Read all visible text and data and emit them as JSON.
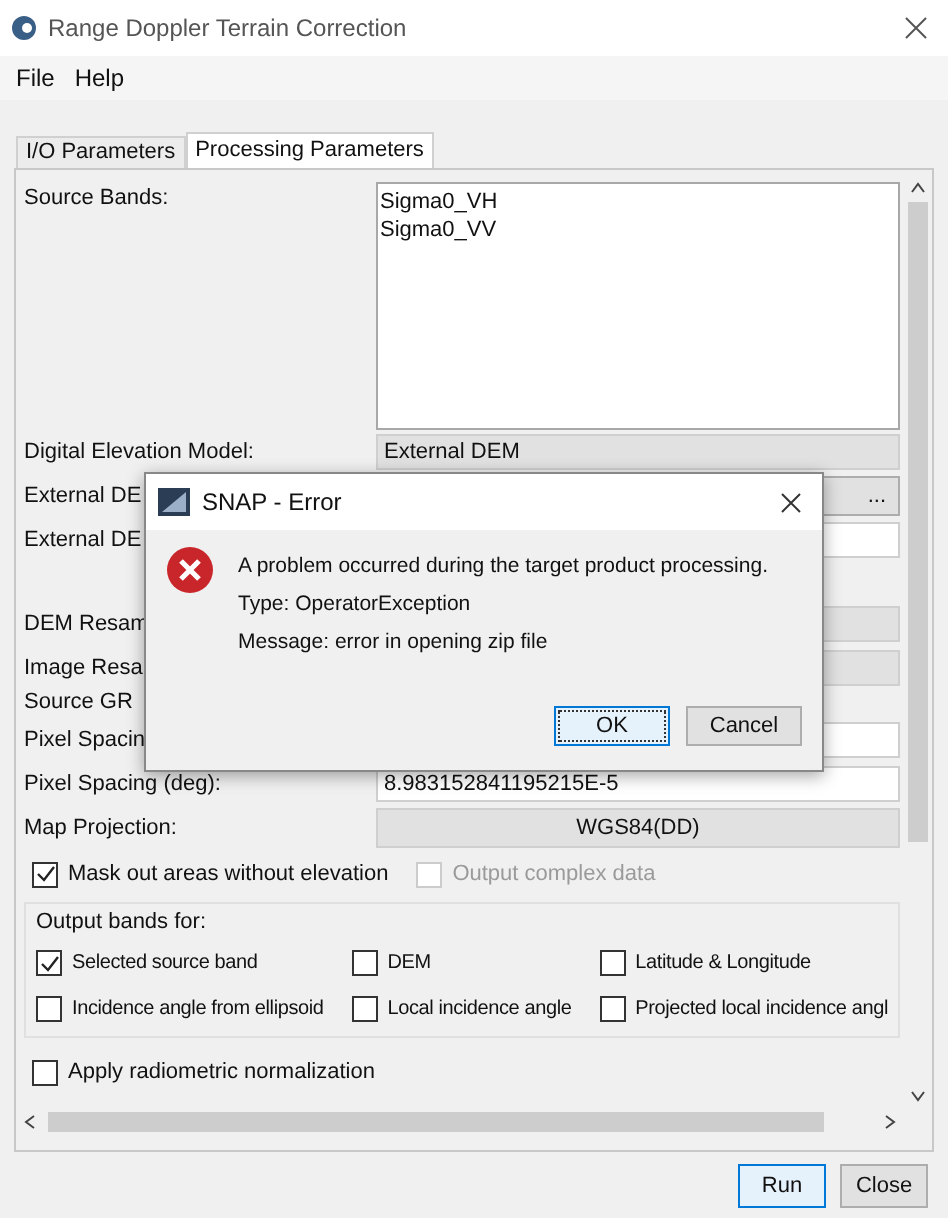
{
  "window": {
    "title": "Range Doppler Terrain Correction"
  },
  "menu": [
    "File",
    "Help"
  ],
  "tabs": [
    {
      "label": "I/O Parameters",
      "selected": false
    },
    {
      "label": "Processing Parameters",
      "selected": true
    }
  ],
  "source_bands": {
    "label": "Source Bands:",
    "items": [
      {
        "label": "Sigma0_VH",
        "selected": false
      },
      {
        "label": "Sigma0_VV",
        "selected": false
      }
    ]
  },
  "rows": [
    {
      "kind": "combo",
      "label": "Digital Elevation Model:",
      "value": "External DEM"
    },
    {
      "kind": "browse",
      "label": "External DE",
      "button": "..."
    },
    {
      "kind": "field",
      "label": "External DE"
    },
    {
      "kind": "blank"
    },
    {
      "kind": "combo",
      "label": "DEM Resam"
    },
    {
      "kind": "combo",
      "label": "Image Resa"
    },
    {
      "kind": "label",
      "label": "Source GR"
    },
    {
      "kind": "field",
      "label": "Pixel Spacin"
    },
    {
      "kind": "field",
      "label": "Pixel Spacing (deg):",
      "value": "8.983152841195215E-5"
    },
    {
      "kind": "button",
      "label": "Map Projection:",
      "value": "WGS84(DD)"
    }
  ],
  "options": [
    {
      "label": "Mask out areas without elevation",
      "checked": true,
      "disabled": false
    },
    {
      "label": "Output complex data",
      "checked": false,
      "disabled": true
    }
  ],
  "output_bands": {
    "title": "Output bands for:",
    "options": [
      {
        "label": "Selected source band",
        "checked": true
      },
      {
        "label": "DEM",
        "checked": false
      },
      {
        "label": "Latitude & Longitude",
        "checked": false
      },
      {
        "label": "Incidence angle from ellipsoid",
        "checked": false
      },
      {
        "label": "Local incidence angle",
        "checked": false
      },
      {
        "label": "Projected local incidence angl",
        "checked": false
      }
    ]
  },
  "radiometric": {
    "label": "Apply radiometric normalization",
    "checked": false
  },
  "buttons": [
    {
      "label": "Run",
      "focused": true
    },
    {
      "label": "Close",
      "focused": false
    }
  ],
  "dialog": {
    "title": "SNAP - Error",
    "lines": [
      "A problem occurred during the target product processing.",
      "Type: OperatorException",
      "Message: error in opening zip file"
    ],
    "buttons": [
      {
        "label": "OK",
        "focused": true
      },
      {
        "label": "Cancel",
        "focused": false
      }
    ]
  }
}
